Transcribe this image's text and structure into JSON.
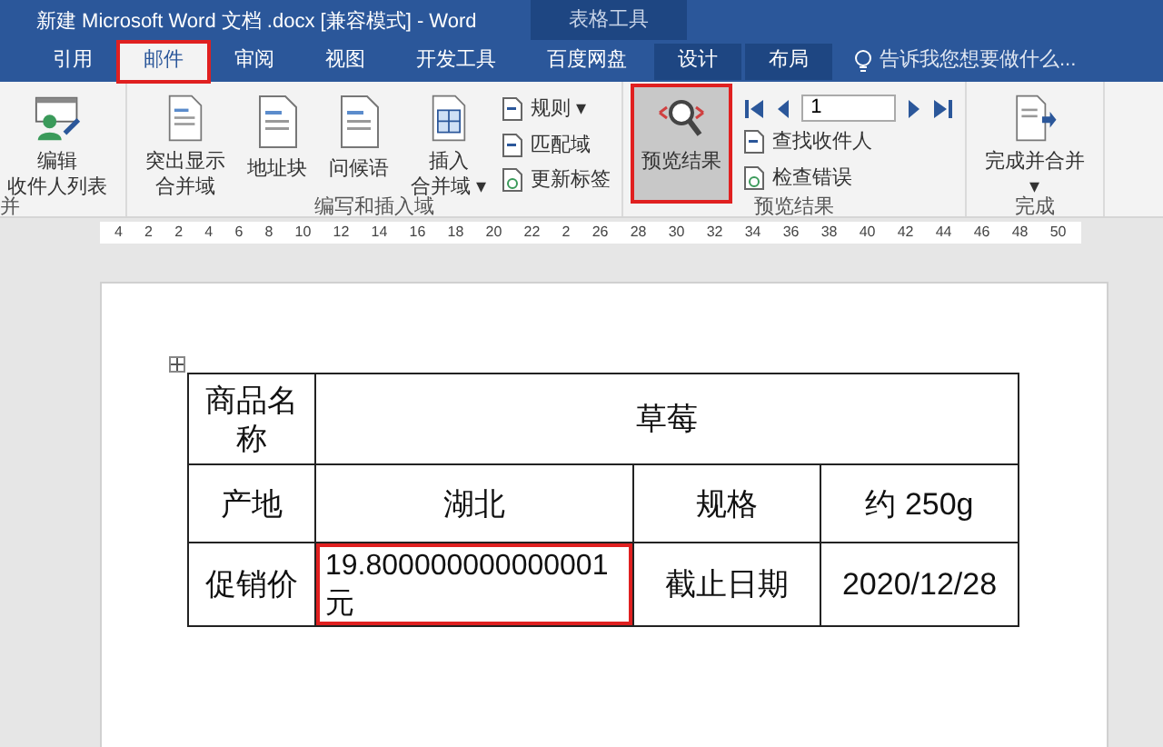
{
  "window": {
    "title": "新建 Microsoft Word 文档 .docx [兼容模式] - Word",
    "context_tab_group": "表格工具"
  },
  "tabs": [
    {
      "label": "引用",
      "selected": false
    },
    {
      "label": "邮件",
      "selected": true
    },
    {
      "label": "审阅",
      "selected": false
    },
    {
      "label": "视图",
      "selected": false
    },
    {
      "label": "开发工具",
      "selected": false
    },
    {
      "label": "百度网盘",
      "selected": false
    },
    {
      "label": "设计",
      "selected": false
    },
    {
      "label": "布局",
      "selected": false
    }
  ],
  "tell_me": {
    "placeholder": "告诉我您想要做什么..."
  },
  "ribbon": {
    "groups": [
      {
        "label": "并",
        "items": [
          {
            "kind": "large",
            "lines": [
              "编辑",
              "收件人列表"
            ],
            "selected": false
          }
        ]
      },
      {
        "label": "编写和插入域",
        "items": [
          {
            "kind": "large",
            "lines": [
              "突出显示",
              "合并域"
            ],
            "selected": false
          },
          {
            "kind": "large",
            "lines": [
              "地址块"
            ],
            "selected": false
          },
          {
            "kind": "large",
            "lines": [
              "问候语"
            ],
            "selected": false
          },
          {
            "kind": "large",
            "lines": [
              "插入",
              "合并域 ▾"
            ],
            "selected": false
          },
          {
            "kind": "small",
            "labels": [
              "规则 ▾",
              "匹配域",
              "更新标签"
            ]
          }
        ]
      },
      {
        "label": "预览结果",
        "items": [
          {
            "kind": "large",
            "lines": [
              "预览结果"
            ],
            "selected": true
          },
          {
            "kind": "nav",
            "record": "1",
            "labels": [
              "查找收件人",
              "检查错误"
            ]
          }
        ]
      },
      {
        "label": "完成",
        "items": [
          {
            "kind": "large",
            "lines": [
              "完成并合并",
              "▾"
            ],
            "selected": false
          }
        ]
      }
    ]
  },
  "ruler": {
    "ticks": [
      "4",
      "2",
      "2",
      "4",
      "6",
      "8",
      "10",
      "12",
      "14",
      "16",
      "18",
      "20",
      "22",
      "2",
      "26",
      "28",
      "30",
      "32",
      "34",
      "36",
      "38",
      "40",
      "42",
      "44",
      "46",
      "48",
      "50"
    ]
  },
  "table": {
    "rows": [
      [
        {
          "text": "商品名称",
          "selected": false
        },
        {
          "text": "草莓",
          "selected": false
        }
      ],
      [
        {
          "text": "产地",
          "selected": false
        },
        {
          "text": "湖北",
          "selected": false
        },
        {
          "text": "规格",
          "selected": false
        },
        {
          "text": "约 250g",
          "selected": false
        }
      ],
      [
        {
          "text": "促销价",
          "selected": false
        },
        {
          "text": "19.800000000000001元",
          "selected": true
        },
        {
          "text": "截止日期",
          "selected": false
        },
        {
          "text": "2020/12/28",
          "selected": false
        }
      ]
    ]
  }
}
